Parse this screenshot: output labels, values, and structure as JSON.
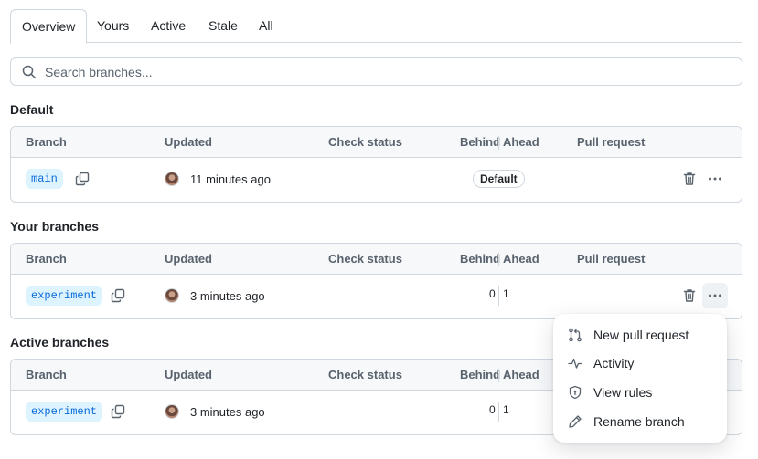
{
  "tabs": [
    {
      "label": "Overview",
      "selected": true
    },
    {
      "label": "Yours",
      "selected": false
    },
    {
      "label": "Active",
      "selected": false
    },
    {
      "label": "Stale",
      "selected": false
    },
    {
      "label": "All",
      "selected": false
    }
  ],
  "search": {
    "placeholder": "Search branches..."
  },
  "columns": {
    "branch": "Branch",
    "updated": "Updated",
    "check_status": "Check status",
    "behind": "Behind",
    "ahead": "Ahead",
    "pull_request": "Pull request"
  },
  "sections": [
    {
      "title": "Default",
      "row": {
        "branch": "main",
        "updated": "11 minutes ago",
        "badge": "Default"
      }
    },
    {
      "title": "Your branches",
      "row": {
        "branch": "experiment",
        "updated": "3 minutes ago",
        "behind": "0",
        "ahead": "1"
      }
    },
    {
      "title": "Active branches",
      "row": {
        "branch": "experiment",
        "updated": "3 minutes ago",
        "behind": "0",
        "ahead": "1"
      }
    }
  ],
  "menu": {
    "items": [
      {
        "label": "New pull request",
        "icon": "git-pull-request-icon"
      },
      {
        "label": "Activity",
        "icon": "pulse-icon"
      },
      {
        "label": "View rules",
        "icon": "shield-icon"
      },
      {
        "label": "Rename branch",
        "icon": "pencil-icon"
      }
    ]
  },
  "colors": {
    "accent": "#0969da",
    "branch_pill_bg": "#ddf4ff",
    "border": "#d0d7de",
    "header_bg": "#f6f8fa",
    "muted_text": "#59636e"
  }
}
